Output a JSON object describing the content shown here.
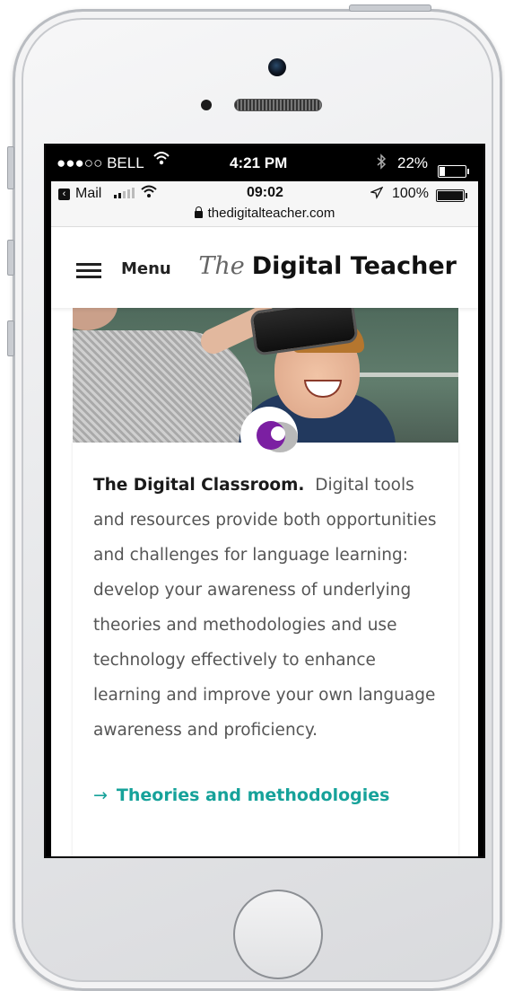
{
  "status_outer": {
    "carrier": "●●●○○ BELL",
    "wifi_icon": "wifi-icon",
    "time": "4:21 PM",
    "bluetooth_icon": "bluetooth-icon",
    "battery_percent": "22%",
    "battery_level": 0.22
  },
  "status_inner": {
    "back_app": "Mail",
    "time": "09:02",
    "location_icon": "location-arrow-icon",
    "battery_percent": "100%",
    "battery_level": 1.0,
    "url": "thedigitalteacher.com"
  },
  "site_header": {
    "menu_label": "Menu",
    "brand_the": "The",
    "brand_name": "Digital Teacher"
  },
  "article": {
    "lead_bold": "The Digital Classroom.",
    "body": "Digital tools and resources provide both opportunities and challenges for language learning: develop your awareness of underlying theories and methodologies and use technology effectively to enhance learning and improve your own language awareness and proficiency.",
    "link_arrow": "→",
    "link_label": "Theories and methodologies"
  },
  "colors": {
    "link": "#16a29a",
    "logo_purple": "#7b1fa2"
  }
}
